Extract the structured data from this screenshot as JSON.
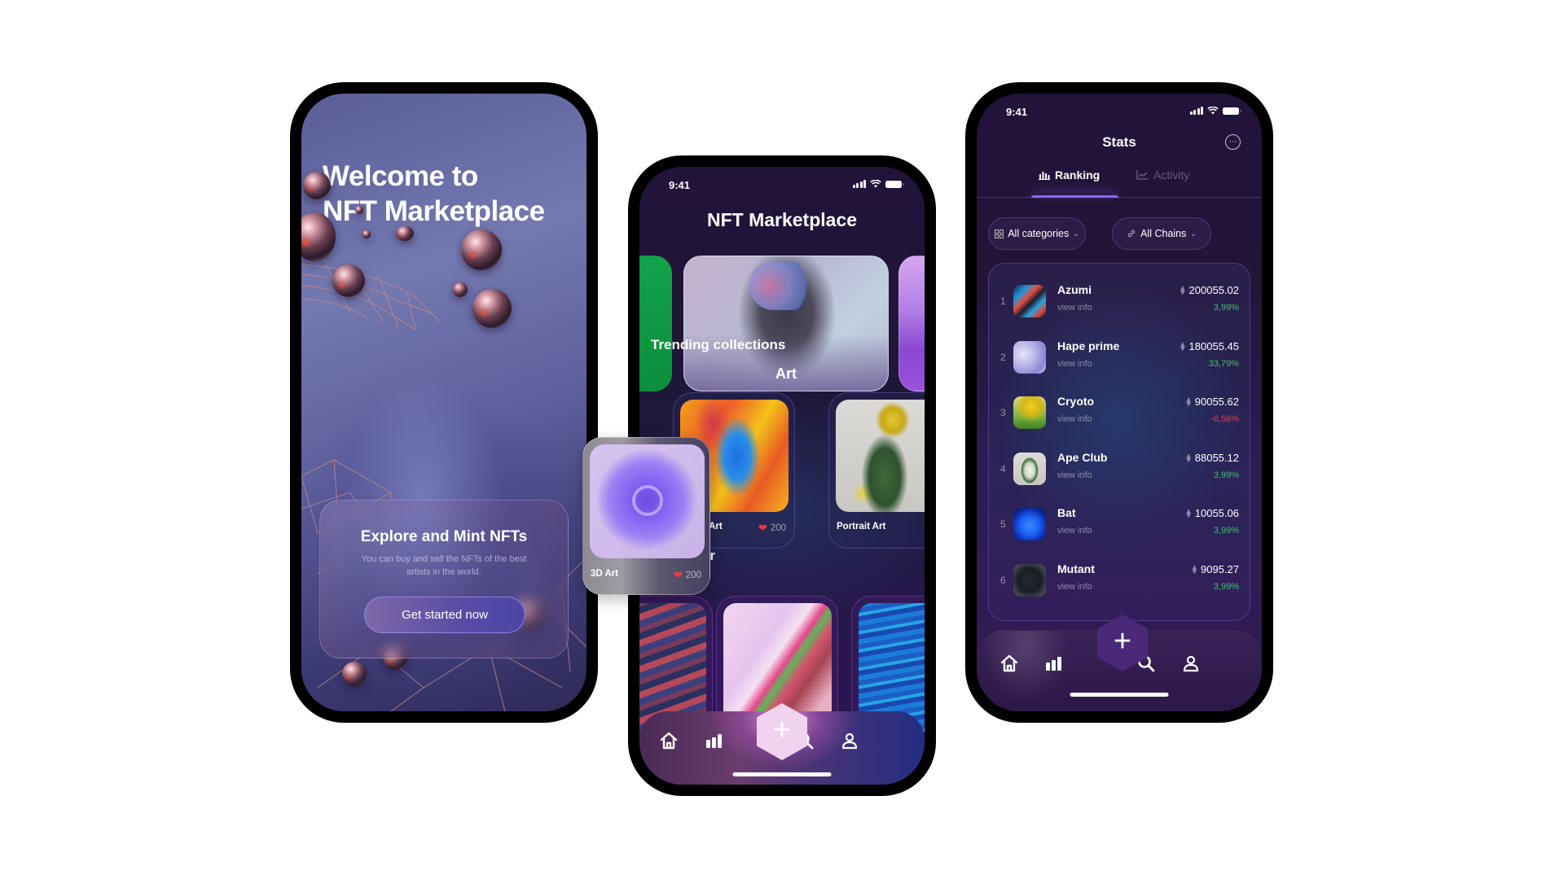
{
  "onboarding": {
    "title_line1": "Welcome to",
    "title_line2": "NFT Marketplace",
    "card_title": "Explore and Mint NFTs",
    "card_text": "You can buy and sell the NFTs of the best artists in the world.",
    "cta_label": "Get started now"
  },
  "home": {
    "status_time": "9:41",
    "title": "NFT Marketplace",
    "featured_category": "Art",
    "trending_title": "Trending collections",
    "trending": [
      {
        "name": "3D Art",
        "likes": "200"
      },
      {
        "name": "Abstract Art",
        "name_visible": "stract Art",
        "likes": "200"
      },
      {
        "name": "Portrait Art",
        "likes": ""
      }
    ],
    "top_seller_title": "Top seller",
    "add_label": "+"
  },
  "stats": {
    "status_time": "9:41",
    "title": "Stats",
    "more_icon": "⋯",
    "tabs": [
      {
        "label": "Ranking",
        "icon": "bar-chart-icon",
        "active": true
      },
      {
        "label": "Activity",
        "icon": "line-chart-icon",
        "active": false
      }
    ],
    "filters": [
      {
        "label": "All categories",
        "icon": "grid-icon"
      },
      {
        "label": "All Chains",
        "icon": "link-icon"
      }
    ],
    "ranking": [
      {
        "rank": "1",
        "name": "Azumi",
        "sub": "view info",
        "price": "200055.02",
        "change": "3,99%",
        "trend": "up"
      },
      {
        "rank": "2",
        "name": "Hape prime",
        "sub": "view info",
        "price": "180055.45",
        "change": "33,79%",
        "trend": "up"
      },
      {
        "rank": "3",
        "name": "Cryoto",
        "sub": "view info",
        "price": "90055.62",
        "change": "-6,56%",
        "trend": "down"
      },
      {
        "rank": "4",
        "name": "Ape Club",
        "sub": "view info",
        "price": "88055.12",
        "change": "3,99%",
        "trend": "up"
      },
      {
        "rank": "5",
        "name": "Bat",
        "sub": "view info",
        "price": "10055.06",
        "change": "3,99%",
        "trend": "up"
      },
      {
        "rank": "6",
        "name": "Mutant",
        "sub": "view info",
        "price": "9095.27",
        "change": "3,99%",
        "trend": "up"
      }
    ],
    "add_label": "+"
  },
  "tabbar": [
    "home-icon",
    "stats-icon",
    "add-icon",
    "search-icon",
    "profile-icon"
  ],
  "colors": {
    "accent": "#8f65ff",
    "positive": "#3bc46a",
    "negative": "#ef3b4b",
    "heart": "#f03a3a"
  }
}
